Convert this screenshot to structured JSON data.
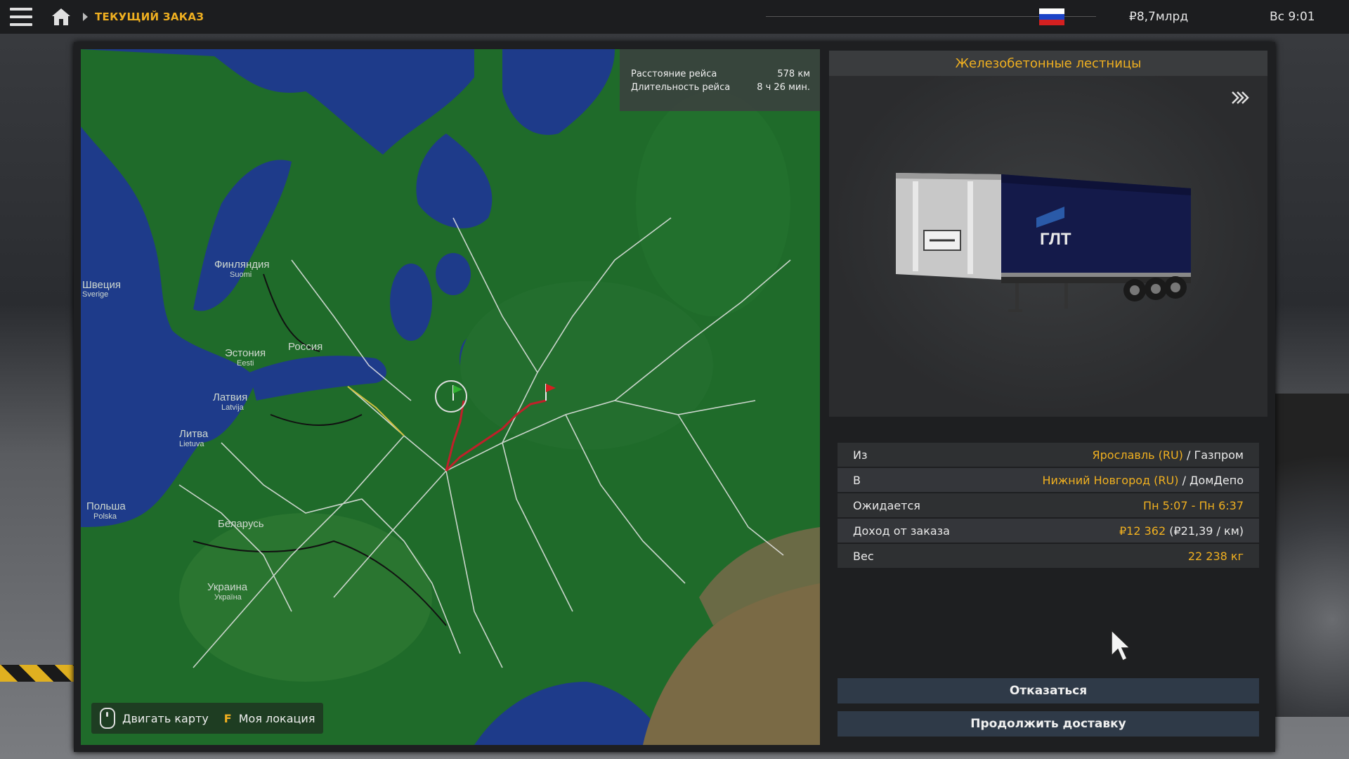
{
  "topbar": {
    "breadcrumb": "ТЕКУЩИЙ ЗАКАЗ",
    "money": "₽8,7млрд",
    "clock": "Вс 9:01",
    "flag_colors": [
      "#ffffff",
      "#1c44c8",
      "#d42020"
    ]
  },
  "map": {
    "distance_label": "Расстояние рейса",
    "distance_value": "578 км",
    "duration_label": "Длительность рейса",
    "duration_value": "8 ч 26 мин.",
    "controls": {
      "move_label": "Двигать карту",
      "location_key": "F",
      "location_label": "Моя локация"
    },
    "country_labels": [
      {
        "name": "Финляндия",
        "sub": "Suomi"
      },
      {
        "name": "Швеция",
        "sub": "Sverige"
      },
      {
        "name": "Эстония",
        "sub": "Eesti"
      },
      {
        "name": "Россия",
        "sub": ""
      },
      {
        "name": "Латвия",
        "sub": "Latvija"
      },
      {
        "name": "Литва",
        "sub": "Lietuva"
      },
      {
        "name": "Польша",
        "sub": "Polska"
      },
      {
        "name": "Беларусь",
        "sub": ""
      },
      {
        "name": "Украина",
        "sub": "Україна"
      }
    ]
  },
  "cargo": {
    "title": "Железобетонные лестницы",
    "trailer_brand": "ГЛТ"
  },
  "details": {
    "from_label": "Из",
    "from_city": "Ярославль (RU)",
    "from_company": "Газпром",
    "to_label": "В",
    "to_city": "Нижний Новгород (RU)",
    "to_company": "ДомДепо",
    "expected_label": "Ожидается",
    "expected_value": "Пн 5:07 - Пн 6:37",
    "income_label": "Доход от заказа",
    "income_value": "₽12 362",
    "income_rate": "(₽21,39 / км)",
    "weight_label": "Вес",
    "weight_value": "22 238 кг"
  },
  "buttons": {
    "decline": "Отказаться",
    "continue": "Продолжить доставку"
  },
  "colors": {
    "accent": "#f0b020",
    "map_land": "#1f6b2a",
    "map_water": "#1e3b8a",
    "route": "#c0202a",
    "button_bg": "#2f3a48"
  }
}
